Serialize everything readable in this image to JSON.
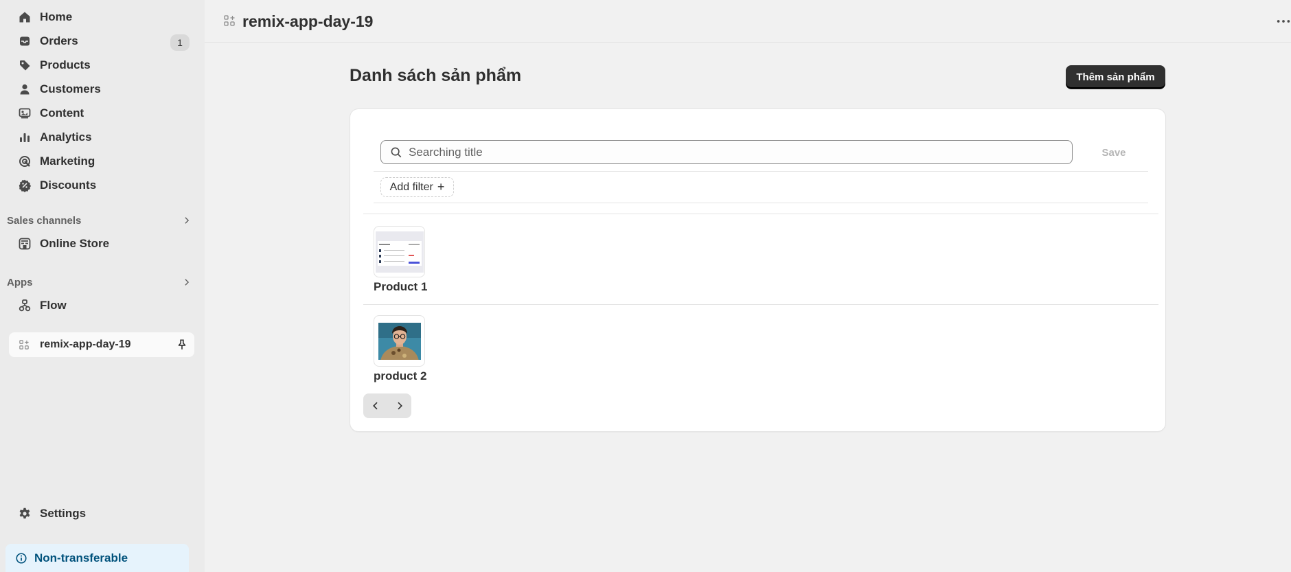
{
  "sidebar": {
    "items": [
      {
        "label": "Home",
        "icon": "home-icon"
      },
      {
        "label": "Orders",
        "icon": "orders-icon",
        "badge": "1"
      },
      {
        "label": "Products",
        "icon": "tag-icon"
      },
      {
        "label": "Customers",
        "icon": "person-icon"
      },
      {
        "label": "Content",
        "icon": "content-icon"
      },
      {
        "label": "Analytics",
        "icon": "bar-chart-icon"
      },
      {
        "label": "Marketing",
        "icon": "target-icon"
      },
      {
        "label": "Discounts",
        "icon": "discount-icon"
      }
    ],
    "sales_channels": {
      "heading": "Sales channels",
      "items": [
        {
          "label": "Online Store",
          "icon": "store-icon"
        }
      ]
    },
    "apps": {
      "heading": "Apps",
      "items": [
        {
          "label": "Flow",
          "icon": "flow-icon"
        }
      ]
    },
    "pinned_app": {
      "label": "remix-app-day-19",
      "icon": "app-grid-icon"
    },
    "settings": {
      "label": "Settings",
      "icon": "gear-icon"
    },
    "non_transferable": {
      "label": "Non-transferable",
      "icon": "info-icon"
    }
  },
  "topbar": {
    "title": "remix-app-day-19",
    "more_icon": "ellipsis-icon"
  },
  "main": {
    "title": "Danh sách sản phẩm",
    "add_button": "Thêm sản phẩm",
    "search": {
      "placeholder": "Searching title",
      "value": ""
    },
    "save_button": "Save",
    "add_filter": "Add filter",
    "products": [
      {
        "name": "Product 1",
        "image": "screenshot thumbnail"
      },
      {
        "name": "product 2",
        "image": "person photo"
      }
    ]
  },
  "colors": {
    "primary_button": "#303030",
    "sidebar_bg": "#ebebeb",
    "page_bg": "#f1f1f1",
    "info_bg": "#e6f3fc",
    "info_text": "#00527c"
  }
}
